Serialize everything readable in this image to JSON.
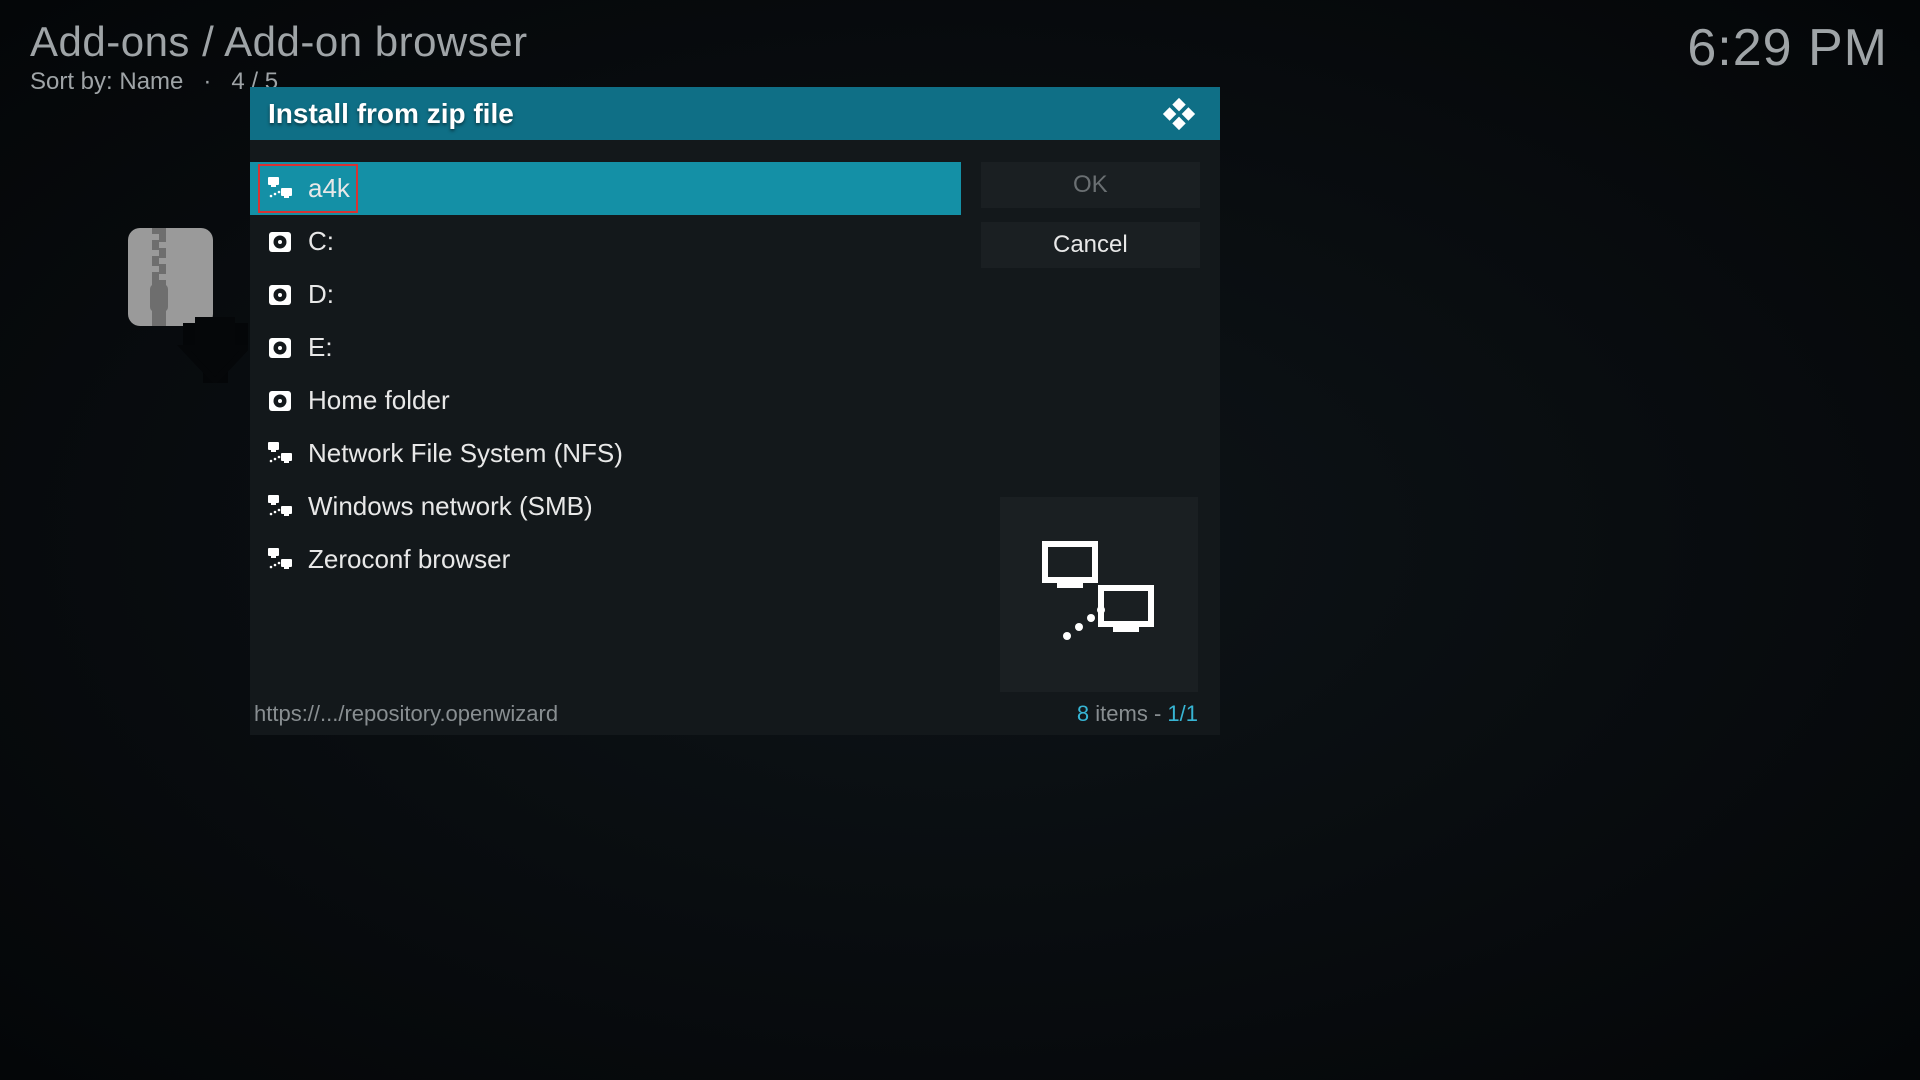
{
  "header": {
    "breadcrumb": "Add-ons / Add-on browser",
    "sort_label": "Sort by: Name",
    "page_index": "4 / 5"
  },
  "clock": "6:29 PM",
  "dialog": {
    "title": "Install from zip file",
    "buttons": {
      "ok": "OK",
      "cancel": "Cancel"
    },
    "items": [
      {
        "label": "a4k",
        "icon": "network",
        "selected": true
      },
      {
        "label": "C:",
        "icon": "drive",
        "selected": false
      },
      {
        "label": "D:",
        "icon": "drive",
        "selected": false
      },
      {
        "label": "E:",
        "icon": "drive",
        "selected": false
      },
      {
        "label": "Home folder",
        "icon": "drive",
        "selected": false
      },
      {
        "label": "Network File System (NFS)",
        "icon": "network",
        "selected": false
      },
      {
        "label": "Windows network (SMB)",
        "icon": "network",
        "selected": false
      },
      {
        "label": "Zeroconf browser",
        "icon": "network",
        "selected": false
      }
    ],
    "footer_path": "https://.../repository.openwizard",
    "footer_count": "8",
    "footer_items_label": " items - ",
    "footer_page": "1/1"
  }
}
